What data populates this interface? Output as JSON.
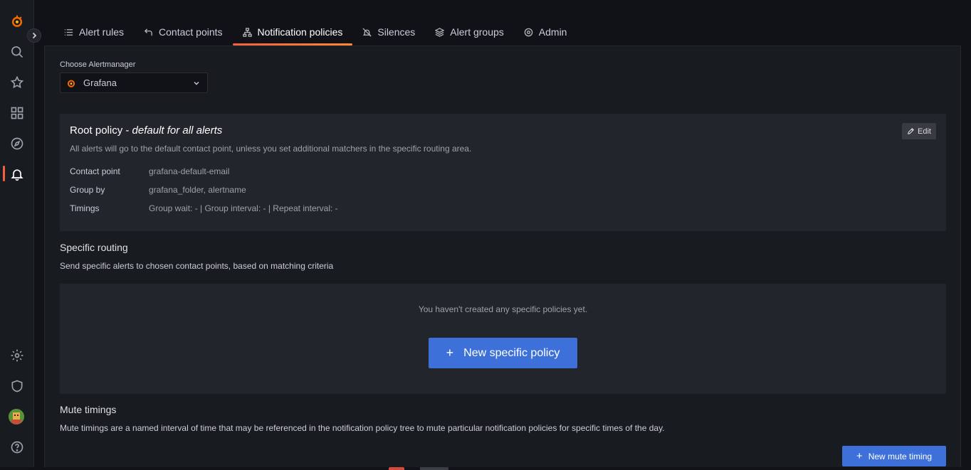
{
  "tabs": [
    {
      "label": "Alert rules",
      "icon": "list-icon"
    },
    {
      "label": "Contact points",
      "icon": "contact-icon"
    },
    {
      "label": "Notification policies",
      "icon": "sitemap-icon"
    },
    {
      "label": "Silences",
      "icon": "bell-slash-icon"
    },
    {
      "label": "Alert groups",
      "icon": "layers-icon"
    },
    {
      "label": "Admin",
      "icon": "cog-icon"
    }
  ],
  "active_tab": "Notification policies",
  "alertmanager": {
    "label": "Choose Alertmanager",
    "selected": "Grafana"
  },
  "root_policy": {
    "title": "Root policy - ",
    "title_em": "default for all alerts",
    "description": "All alerts will go to the default contact point, unless you set additional matchers in the specific routing area.",
    "edit_label": "Edit",
    "contact_point_key": "Contact point",
    "contact_point_value": "grafana-default-email",
    "group_by_key": "Group by",
    "group_by_value": "grafana_folder, alertname",
    "timings_key": "Timings",
    "timings_value": "Group wait: - | Group interval: - | Repeat interval: -"
  },
  "specific_routing": {
    "title": "Specific routing",
    "description": "Send specific alerts to chosen contact points, based on matching criteria",
    "empty_text": "You haven't created any specific policies yet.",
    "button_label": "New specific policy"
  },
  "mute_timings": {
    "title": "Mute timings",
    "description": "Mute timings are a named interval of time that may be referenced in the notification policy tree to mute particular notification policies for specific times of the day.",
    "button_label": "New mute timing"
  },
  "colors": {
    "accent": "#3d71d9",
    "active_tab": "#f55f3e",
    "background": "#111217",
    "panel": "#181b1f"
  }
}
